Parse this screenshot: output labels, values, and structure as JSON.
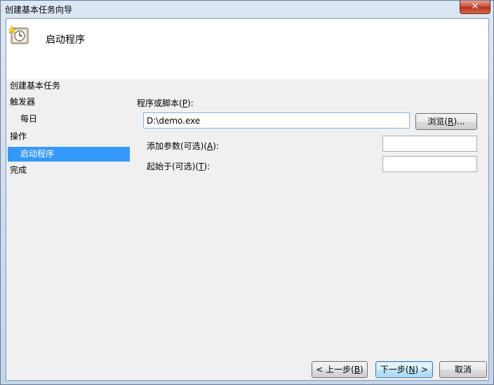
{
  "window": {
    "title": "创建基本任务向导",
    "close_glyph": "✕"
  },
  "header": {
    "title": "启动程序",
    "icon": "clock-task-icon"
  },
  "nav": {
    "sections": [
      {
        "label": "创建基本任务"
      },
      {
        "label": "触发器"
      },
      {
        "label": "操作"
      },
      {
        "label": "完成"
      }
    ],
    "items": [
      {
        "label": "每日"
      },
      {
        "label": "启动程序",
        "selected": true
      }
    ]
  },
  "form": {
    "program_label_prefix": "程序或脚本(",
    "program_label_key": "P",
    "program_label_suffix": "):",
    "program_value": "D:\\demo.exe",
    "browse_prefix": "浏览(",
    "browse_key": "R",
    "browse_suffix": ")...",
    "args_label_prefix": "添加参数(可选)(",
    "args_label_key": "A",
    "args_label_suffix": "):",
    "args_value": "",
    "start_label_prefix": "起始于(可选)(",
    "start_label_key": "T",
    "start_label_suffix": "):",
    "start_value": ""
  },
  "footer": {
    "back_prefix": "< 上一步(",
    "back_key": "B",
    "back_suffix": ")",
    "next_prefix": "下一步(",
    "next_key": "N",
    "next_suffix": ") >",
    "cancel": "取消"
  },
  "colors": {
    "selection": "#3399ff",
    "client_bg": "#f0f0f0"
  }
}
